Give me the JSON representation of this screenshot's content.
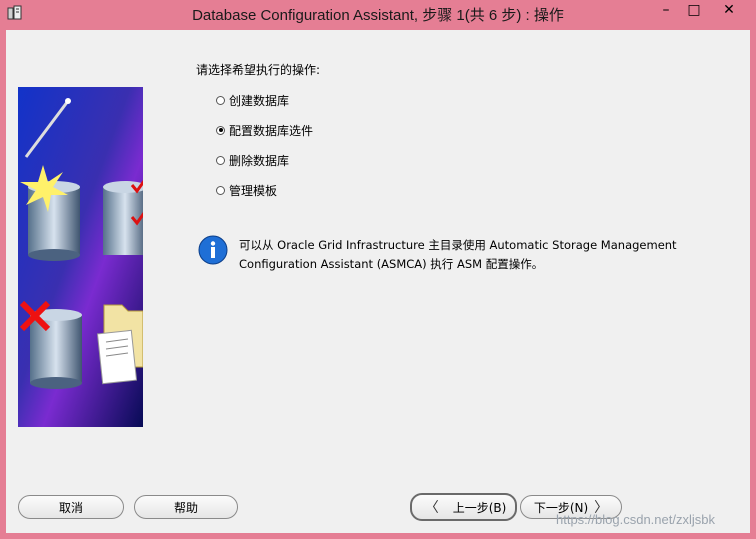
{
  "window": {
    "title": "Database Configuration Assistant, 步骤 1(共 6 步) : 操作",
    "minimize": "–",
    "maximize": "□",
    "close": "✕"
  },
  "prompt": "请选择希望执行的操作:",
  "options": [
    {
      "label": "创建数据库",
      "selected": false
    },
    {
      "label": "配置数据库选件",
      "selected": true
    },
    {
      "label": "删除数据库",
      "selected": false
    },
    {
      "label": "管理模板",
      "selected": false
    }
  ],
  "info": {
    "icon": "info-icon",
    "text": "可以从 Oracle Grid Infrastructure 主目录使用 Automatic Storage Management Configuration Assistant (ASMCA) 执行 ASM 配置操作。"
  },
  "buttons": {
    "cancel": "取消",
    "help": "帮助",
    "back": "上一步(B)",
    "next": "下一步(N)",
    "back_arrow": "〈",
    "next_arrow": "〉"
  },
  "watermark": "https://blog.csdn.net/zxljsbk",
  "colors": {
    "titlebar": "#e57e94",
    "client": "#f0f0f0",
    "info_blue": "#1f6fd6"
  }
}
